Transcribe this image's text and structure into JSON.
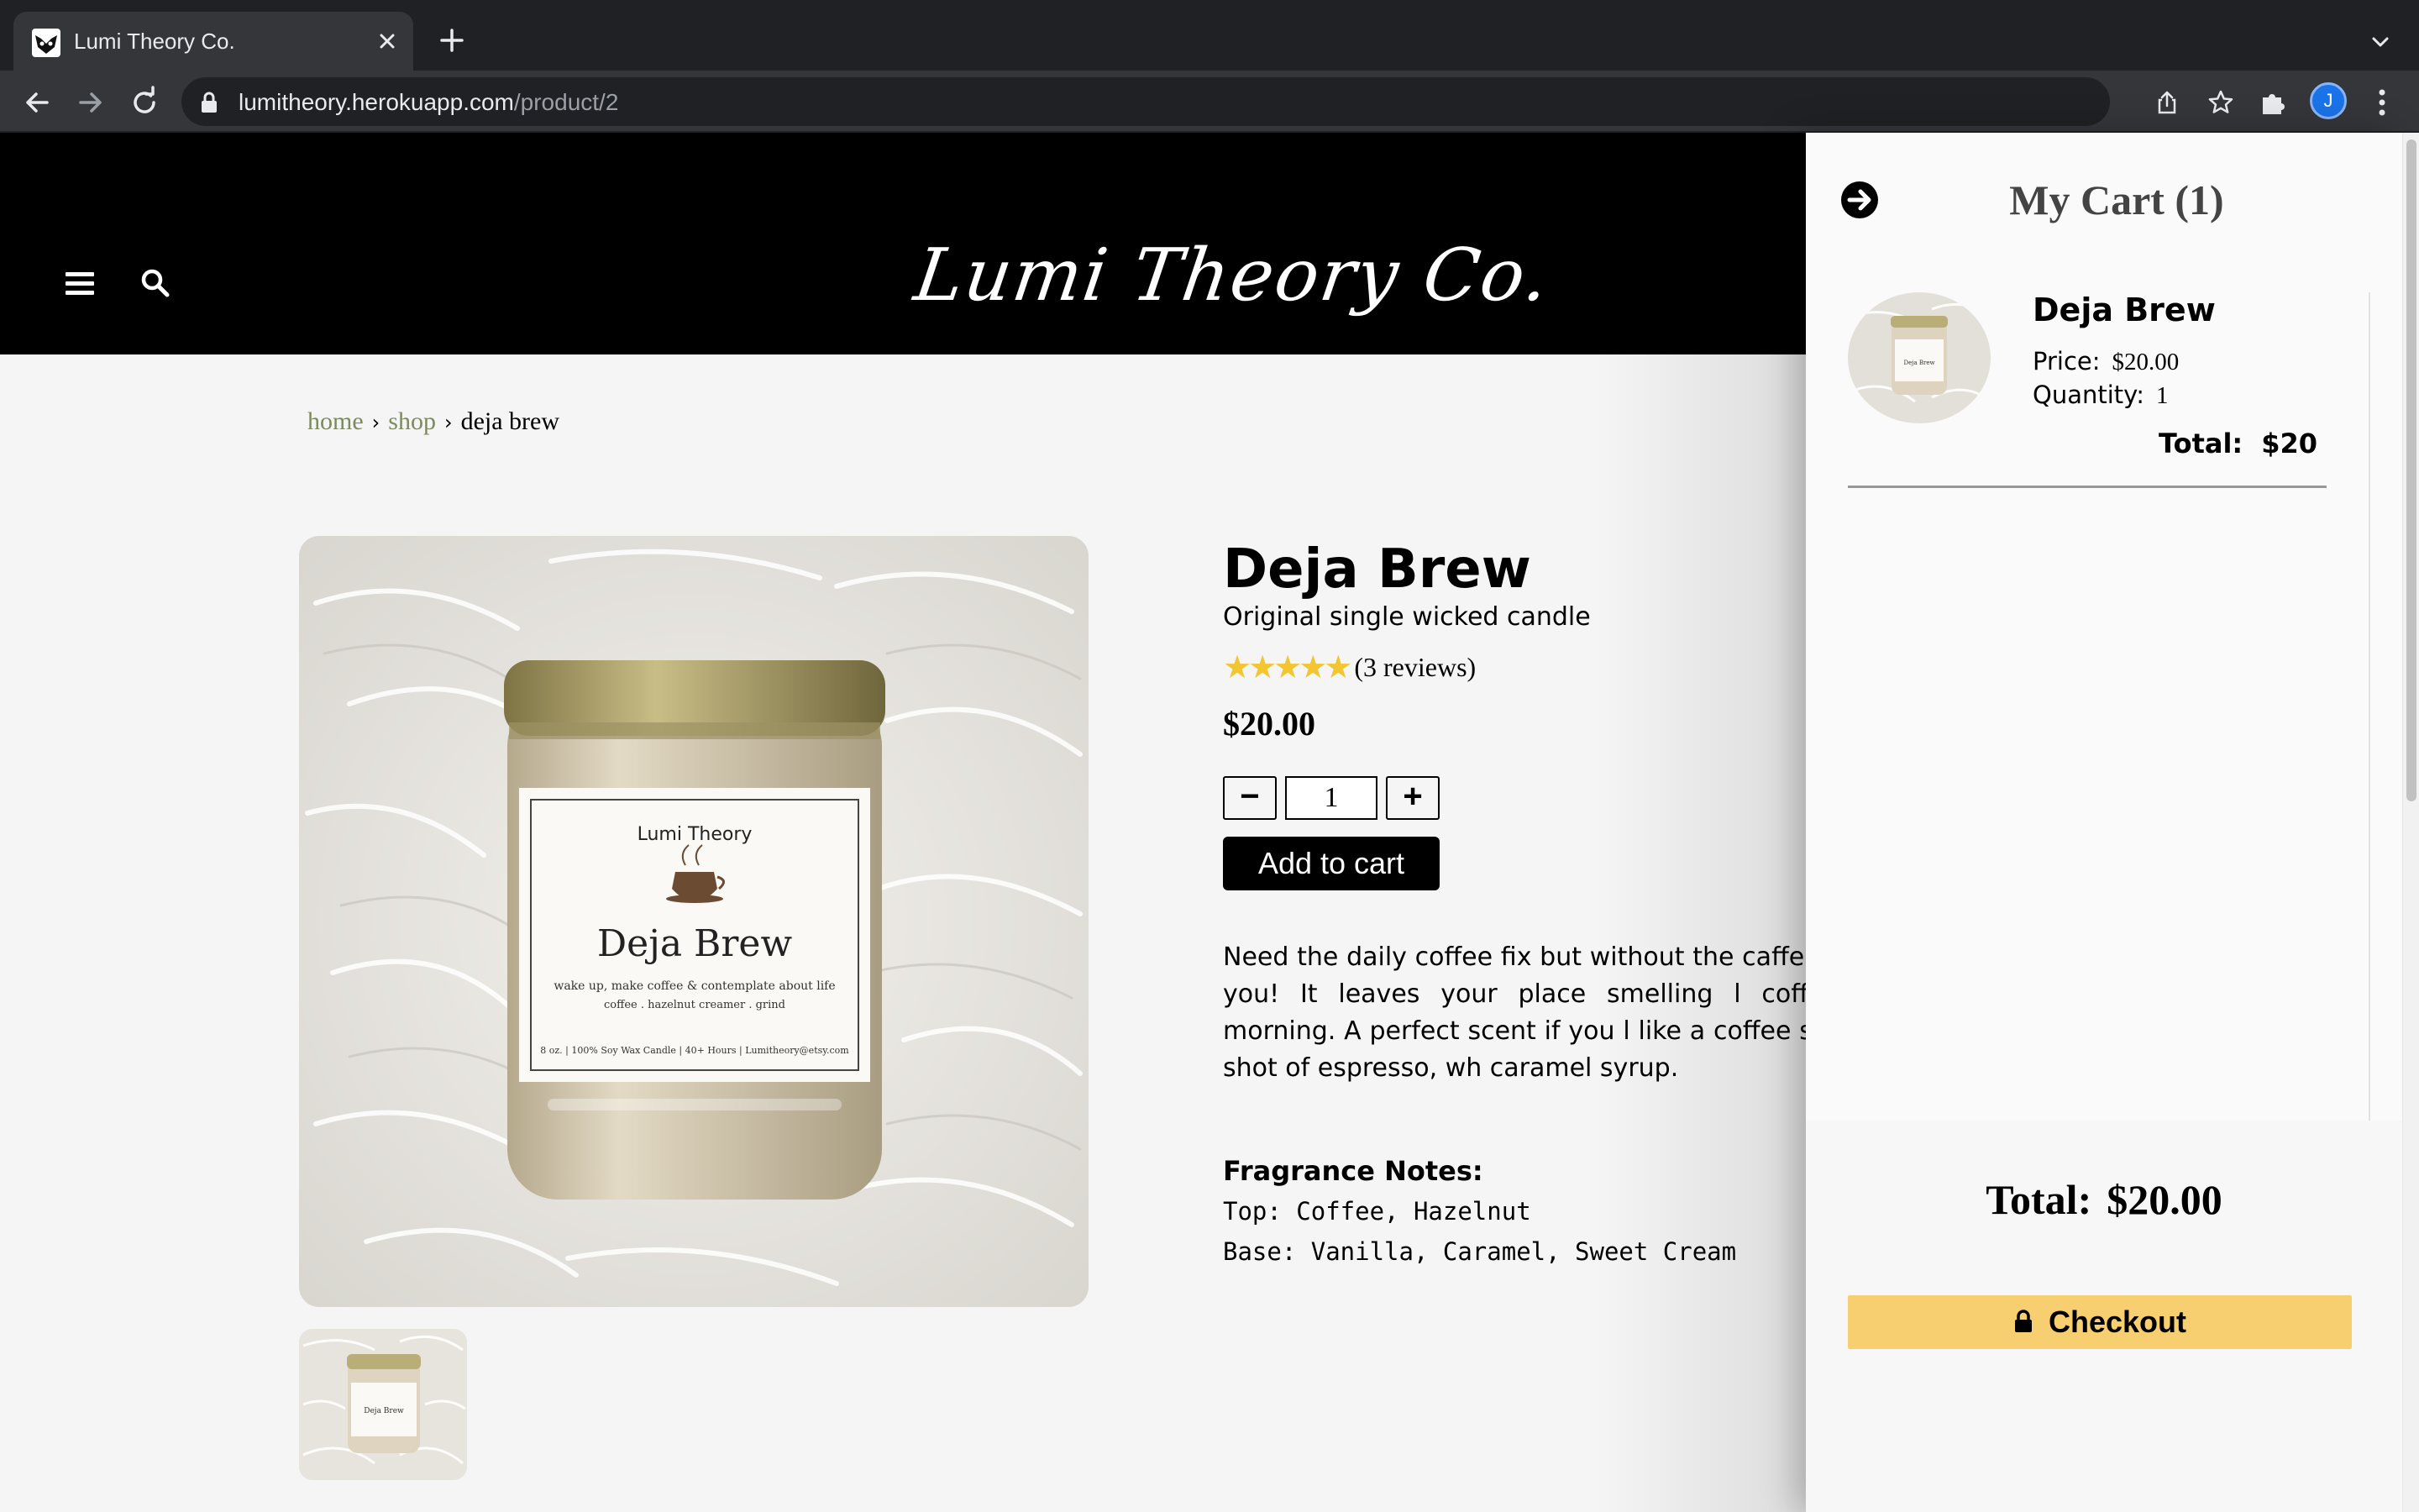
{
  "browser": {
    "tab_title": "Lumi Theory Co.",
    "url_host": "lumitheory.herokuapp.com",
    "url_path": "/product/2",
    "profile_initial": "J"
  },
  "header": {
    "logo_text": "Lumi Theory Co."
  },
  "breadcrumb": {
    "home": "home",
    "shop": "shop",
    "current": "deja brew",
    "separator": "›"
  },
  "product": {
    "title": "Deja Brew",
    "subtitle": "Original single wicked candle",
    "stars": "★★★★★",
    "rating": 5,
    "reviews": "(3 reviews)",
    "price": "$20.00",
    "quantity": "1",
    "minus_label": "−",
    "plus_label": "+",
    "add_to_cart": "Add to cart",
    "description": "Need the daily coffee fix but without the caffe perfect for you! It leaves your place smelling l coffee in the morning. A perfect scent if you l like a coffee shop with a shot of espresso, wh caramel syrup.",
    "notes_title": "Fragrance Notes:",
    "notes_top": "Top: Coffee, Hazelnut",
    "notes_base": "Base: Vanilla, Caramel, Sweet Cream"
  },
  "cart": {
    "title": "My Cart (1)",
    "item": {
      "name": "Deja Brew",
      "price_label": "Price:",
      "price": "$20.00",
      "quantity_label": "Quantity:",
      "quantity": "1",
      "total_label": "Total:",
      "total": "$20"
    },
    "total_label": "Total:",
    "total": "$20.00",
    "checkout": "Checkout"
  },
  "colors": {
    "accent_star": "#f3c531",
    "checkout_button": "#f8cf70",
    "breadcrumb_link": "#7c8a60",
    "header_bg": "#000000"
  }
}
